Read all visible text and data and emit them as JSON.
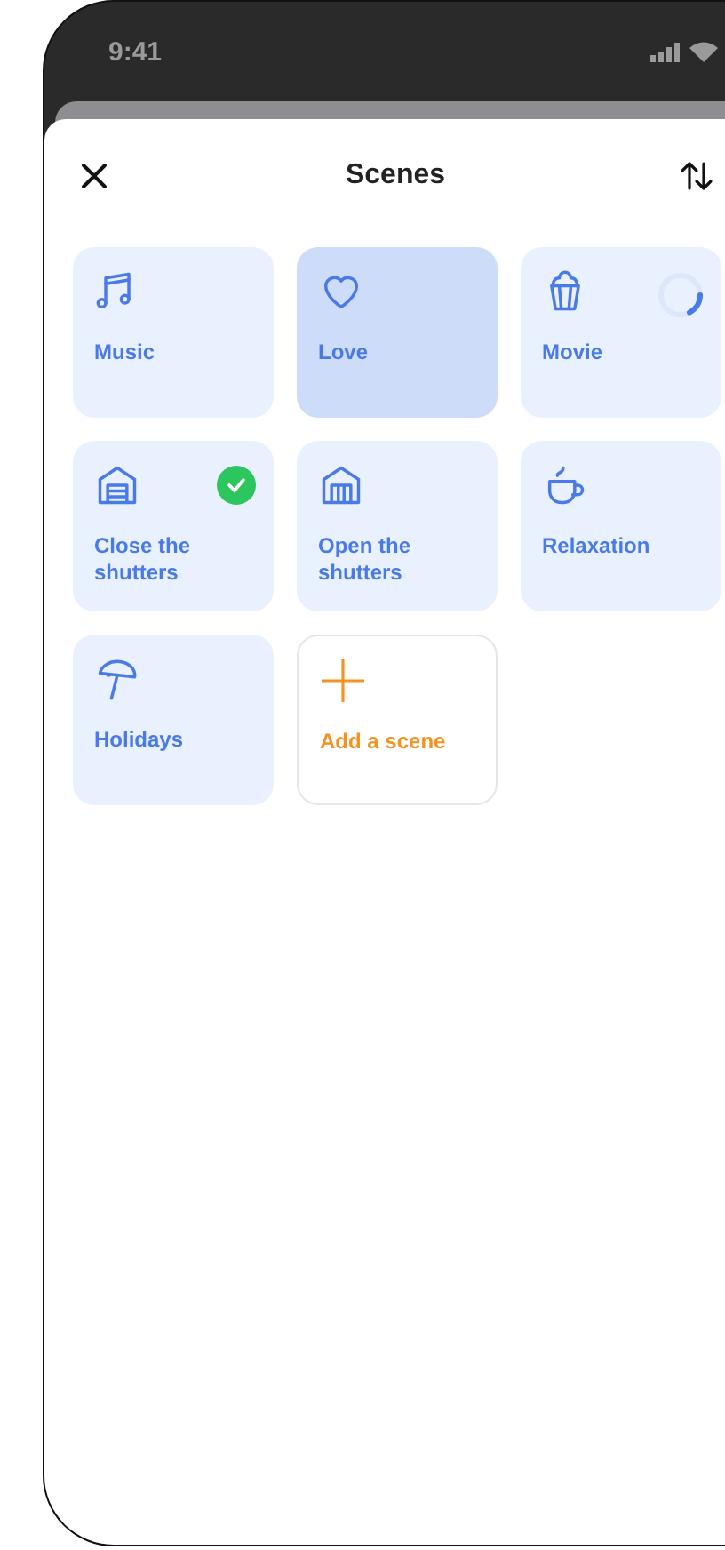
{
  "status_bar": {
    "time": "9:41"
  },
  "header": {
    "title": "Scenes"
  },
  "scenes": [
    {
      "kind": "scene",
      "label": "Music",
      "selected": false,
      "done": false,
      "running": false
    },
    {
      "kind": "scene",
      "label": "Love",
      "selected": true,
      "done": false,
      "running": false
    },
    {
      "kind": "scene",
      "label": "Movie",
      "selected": false,
      "done": false,
      "running": true
    },
    {
      "kind": "scene",
      "label": "Close the shutters",
      "selected": false,
      "done": true,
      "running": false
    },
    {
      "kind": "scene",
      "label": "Open the shutters",
      "selected": false,
      "done": false,
      "running": false
    },
    {
      "kind": "scene",
      "label": "Relaxation",
      "selected": false,
      "done": false,
      "running": false
    },
    {
      "kind": "scene",
      "label": "Holidays",
      "selected": false,
      "done": false,
      "running": false
    },
    {
      "kind": "add",
      "label": "Add a scene",
      "selected": false,
      "done": false,
      "running": false
    }
  ]
}
